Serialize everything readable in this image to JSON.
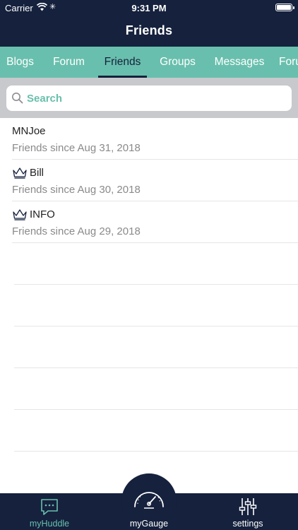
{
  "status_bar": {
    "carrier": "Carrier",
    "time": "9:31 PM"
  },
  "header": {
    "title": "Friends"
  },
  "tabs": [
    {
      "label": "Blogs"
    },
    {
      "label": "Forum"
    },
    {
      "label": "Friends",
      "active": true
    },
    {
      "label": "Groups"
    },
    {
      "label": "Messages"
    },
    {
      "label": "Forums"
    }
  ],
  "search": {
    "placeholder": "Search"
  },
  "friends": [
    {
      "name": "MNJoe",
      "since": "Friends since Aug 31, 2018",
      "crown": false
    },
    {
      "name": "Bill",
      "since": "Friends since Aug 30, 2018",
      "crown": true
    },
    {
      "name": "INFO",
      "since": "Friends since Aug 29, 2018",
      "crown": true
    }
  ],
  "bottom_nav": {
    "myhuddle": "myHuddle",
    "mygauge": "myGauge",
    "settings": "settings"
  },
  "colors": {
    "navy": "#15213d",
    "teal": "#69bfad",
    "searchbar_bg": "#c7c9cc"
  },
  "icons": [
    "wifi-icon",
    "battery-icon",
    "search-icon",
    "crown-icon",
    "chat-icon",
    "gauge-icon",
    "sliders-icon"
  ]
}
